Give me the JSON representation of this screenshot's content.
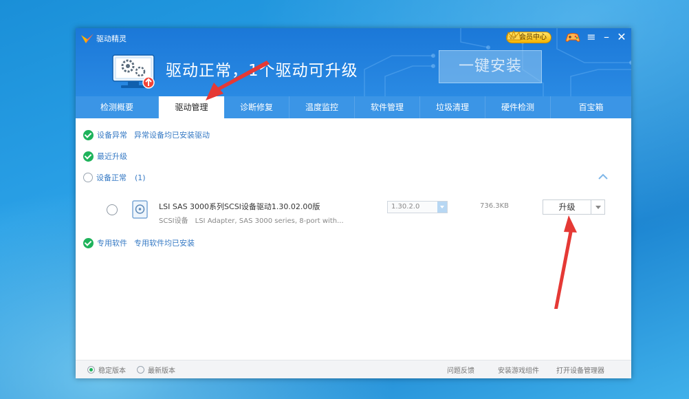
{
  "app": {
    "title": "驱动精灵",
    "vip_label": "会员中心",
    "status_title": "驱动正常，1个驱动可升级",
    "install_button": "一键安装"
  },
  "window_controls": {
    "menu": "≡",
    "minimize": "–",
    "close": "✕"
  },
  "tabs": [
    {
      "label": "检测概要",
      "active": false
    },
    {
      "label": "驱动管理",
      "active": true
    },
    {
      "label": "诊断修复",
      "active": false
    },
    {
      "label": "温度监控",
      "active": false
    },
    {
      "label": "软件管理",
      "active": false
    },
    {
      "label": "垃圾清理",
      "active": false
    },
    {
      "label": "硬件检测",
      "active": false
    },
    {
      "label": "百宝箱",
      "active": false
    }
  ],
  "sections": {
    "abnormal": {
      "label": "设备异常",
      "desc": "异常设备均已安装驱动"
    },
    "recent": {
      "label": "最近升级"
    },
    "normal": {
      "label": "设备正常",
      "count": "(1)"
    },
    "special": {
      "label": "专用软件",
      "desc": "专用软件均已安装"
    }
  },
  "driver": {
    "name": "LSI SAS 3000系列SCSI设备驱动1.30.02.00版",
    "category": "SCSI设备",
    "description": "LSI Adapter, SAS 3000 series, 8-port with...",
    "version": "1.30.2.0",
    "size": "736.3KB",
    "action": "升级"
  },
  "footer": {
    "stable": "稳定版本",
    "latest": "最新版本",
    "stable_selected": true,
    "feedback": "问题反馈",
    "install_game": "安装游戏组件",
    "device_manager": "打开设备管理器"
  },
  "colors": {
    "header_blue": "#1b78d8",
    "tab_bar": "#3b95e6",
    "check_green": "#1fb35b",
    "link_blue": "#3579c4",
    "annotation_red": "#e53935"
  }
}
